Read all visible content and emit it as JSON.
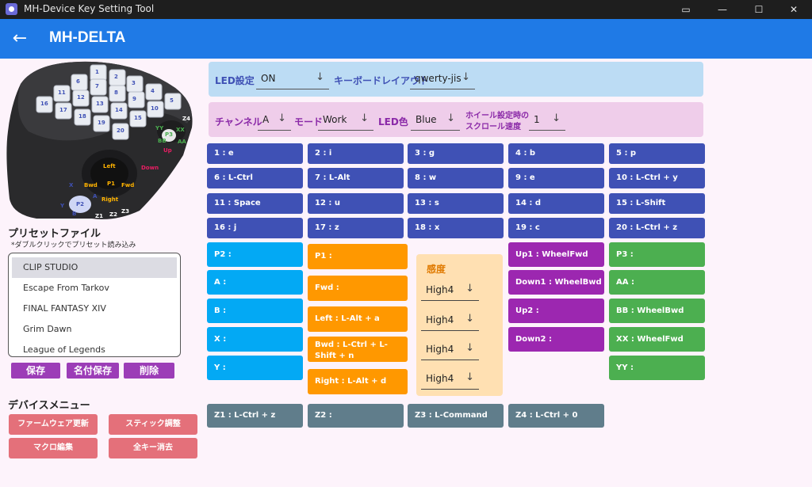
{
  "window": {
    "title": "MH-Device Key Setting Tool"
  },
  "appbar": {
    "back_icon": "←",
    "title": "MH-DELTA"
  },
  "device_image_labels": [
    "1",
    "2",
    "3",
    "4",
    "5",
    "6",
    "7",
    "8",
    "9",
    "10",
    "11",
    "12",
    "13",
    "14",
    "15",
    "16",
    "17",
    "18",
    "19",
    "20",
    "Z4",
    "XX",
    "P3",
    "YY",
    "BB",
    "AA",
    "Up",
    "Down",
    "Left",
    "Bwd",
    "P1",
    "Fwd",
    "A",
    "X",
    "P2",
    "Y",
    "B",
    "Right",
    "Z1",
    "Z2",
    "Z3"
  ],
  "presets": {
    "heading": "プリセットファイル",
    "hint": "*ダブルクリックでプリセット読み込み",
    "items": [
      "CLIP STUDIO",
      "Escape From Tarkov",
      "FINAL FANTASY XIV",
      "Grim Dawn",
      "League of Legends"
    ],
    "selected_index": 0,
    "save": "保存",
    "save_as": "名付保存",
    "delete": "削除"
  },
  "device_menu": {
    "heading": "デバイスメニュー",
    "firmware": "ファームウェア更新",
    "stick": "スティック調整",
    "macro": "マクロ編集",
    "clear_all": "全キー消去"
  },
  "settings": {
    "led_label": "LED設定",
    "led_value": "ON",
    "layout_label": "キーボードレイアウト",
    "layout_value": "qwerty-jis",
    "channel_label": "チャンネル",
    "channel_value": "A",
    "mode_label": "モード",
    "mode_value": "Work",
    "led_color_label": "LED色",
    "led_color_value": "Blue",
    "wheel_label_1": "ホイール設定時の",
    "wheel_label_2": "スクロール速度",
    "wheel_value": "1",
    "dropdown_arrow": "↓"
  },
  "keys": {
    "grid": [
      [
        "1 : e",
        "2 : i",
        "3 : g",
        "4 : b",
        "5 : p"
      ],
      [
        "6 : L-Ctrl",
        "7 : L-Alt",
        "8 : w",
        "9 : e",
        "10 : L-Ctrl + y"
      ],
      [
        "11 : Space",
        "12 : u",
        "13 : s",
        "14 : d",
        "15 : L-Shift"
      ],
      [
        "16 : j",
        "17 : z",
        "18 : x",
        "19 : c",
        "20 : L-Ctrl + z"
      ]
    ],
    "cyan": [
      "P2 :",
      "A :",
      "B :",
      "X :",
      "Y :"
    ],
    "orange": [
      "P1 :",
      "Fwd :",
      "Left : L-Alt + a",
      "Bwd : L-Ctrl + L-Shift + n",
      "Right : L-Alt + d"
    ],
    "purple": [
      "Up1 : WheelFwd",
      "Down1 : WheelBwd",
      "Up2 :",
      "Down2 :"
    ],
    "green": [
      "P3 :",
      "AA :",
      "BB : WheelBwd",
      "XX : WheelFwd",
      "YY :"
    ],
    "bottom": [
      "Z1 : L-Ctrl + z",
      "Z2 :",
      "Z3 : L-Command",
      "Z4 : L-Ctrl + 0"
    ]
  },
  "sensitivity": {
    "title": "感度",
    "values": [
      "High4",
      "High4",
      "High4",
      "High4"
    ]
  },
  "colors": {
    "appbar": "#1f7ae6",
    "key_blue": "#3f51b5",
    "key_cyan": "#03a9f4",
    "key_orange": "#ff9800",
    "key_purple": "#9c27b0",
    "key_green": "#4caf50",
    "key_slate": "#607d8b"
  }
}
